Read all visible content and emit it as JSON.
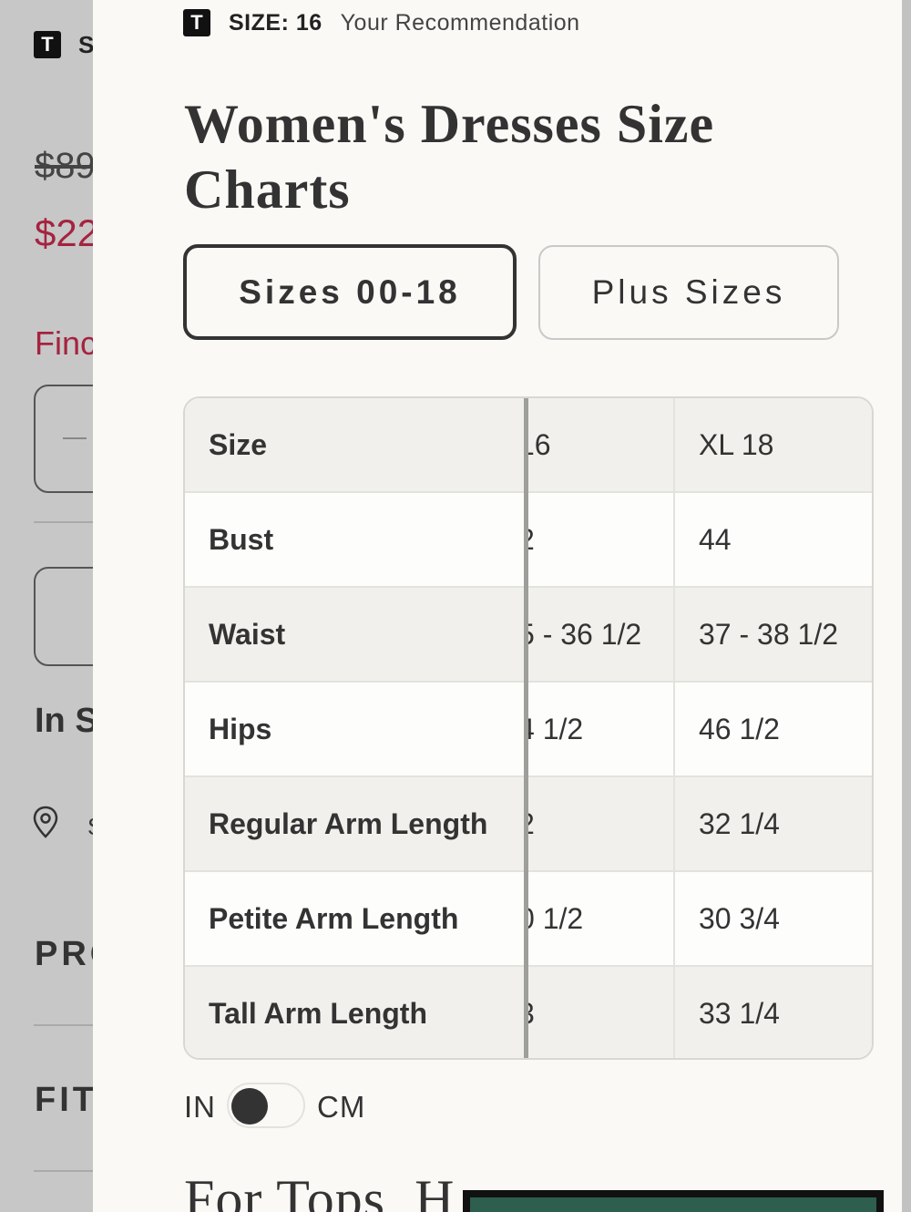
{
  "background": {
    "logo": "T",
    "logo_fragment": "S",
    "original_price_fragment": "$89",
    "sale_price_fragment": "$22",
    "find_fragment": "Finc",
    "in_store_fragment": "In S",
    "location_fragment": "S",
    "product_fragment": "PRO",
    "fit_fragment": "FIT"
  },
  "recommendation": {
    "logo": "T",
    "size_label": "SIZE: 16",
    "text": "Your Recommendation"
  },
  "title": "Women's Dresses Size Charts",
  "tabs": [
    {
      "label": "Sizes 00-18",
      "active": true
    },
    {
      "label": "Plus Sizes",
      "active": false
    }
  ],
  "table": {
    "header": {
      "label": "Size",
      "col_16": "16",
      "col_18": "XL 18"
    },
    "rows": [
      {
        "label": "Bust",
        "col_16": "2",
        "col_18": "44"
      },
      {
        "label": "Waist",
        "col_16": "5 - 36 1/2",
        "col_18": "37 - 38 1/2"
      },
      {
        "label": "Hips",
        "col_16": "4 1/2",
        "col_18": "46 1/2"
      },
      {
        "label": "Regular Arm Length",
        "col_16": "2",
        "col_18": "32 1/4"
      },
      {
        "label": "Petite Arm Length",
        "col_16": "0 1/2",
        "col_18": "30 3/4"
      },
      {
        "label": "Tall Arm Length",
        "col_16": "3",
        "col_18": "33 1/4"
      }
    ]
  },
  "units": {
    "left": "IN",
    "right": "CM",
    "selected": "IN"
  },
  "next_section_title": "For Tops, H",
  "colors": {
    "accent_red": "#a5233f",
    "panel_bg": "#faf9f6",
    "row_shaded": "#f1f0ec",
    "bottom_bar": "#2e5e4e"
  }
}
